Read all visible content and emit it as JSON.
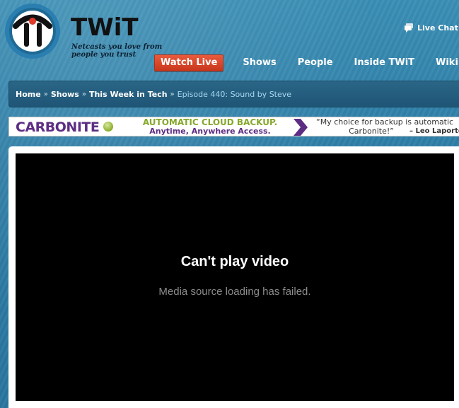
{
  "header": {
    "brand_name": "TWiT",
    "tagline_line1": "Netcasts you love from",
    "tagline_line2": "people you trust",
    "live_chat_label": "Live Chat"
  },
  "nav": {
    "items": [
      {
        "label": "Watch Live"
      },
      {
        "label": "Shows"
      },
      {
        "label": "People"
      },
      {
        "label": "Inside TWiT"
      },
      {
        "label": "Wiki"
      }
    ]
  },
  "breadcrumb": {
    "items": [
      {
        "label": "Home"
      },
      {
        "label": "Shows"
      },
      {
        "label": "This Week in Tech"
      }
    ],
    "separator": "»",
    "current": "Episode 440: Sound by Steve"
  },
  "ad": {
    "brand": "CARBONITE",
    "headline": "AUTOMATIC CLOUD BACKUP.",
    "subline": "Anytime, Anywhere Access.",
    "quote_line1": "“My choice for backup is automatic",
    "quote_line2": "Carbonite!”",
    "attribution": "– Leo Laporte"
  },
  "video": {
    "error_title": "Can't play video",
    "error_message": "Media source loading has failed."
  },
  "colors": {
    "page_bg": "#2f7ea5",
    "watch_live_bg": "#d9462a",
    "breadcrumb_bg": "#245d7e",
    "breadcrumb_current": "#a9d8ef",
    "carbonite_purple": "#5d2d83",
    "carbonite_green": "#86a82c",
    "logo_red": "#e03a2a",
    "logo_blue": "#2a7fb0"
  }
}
